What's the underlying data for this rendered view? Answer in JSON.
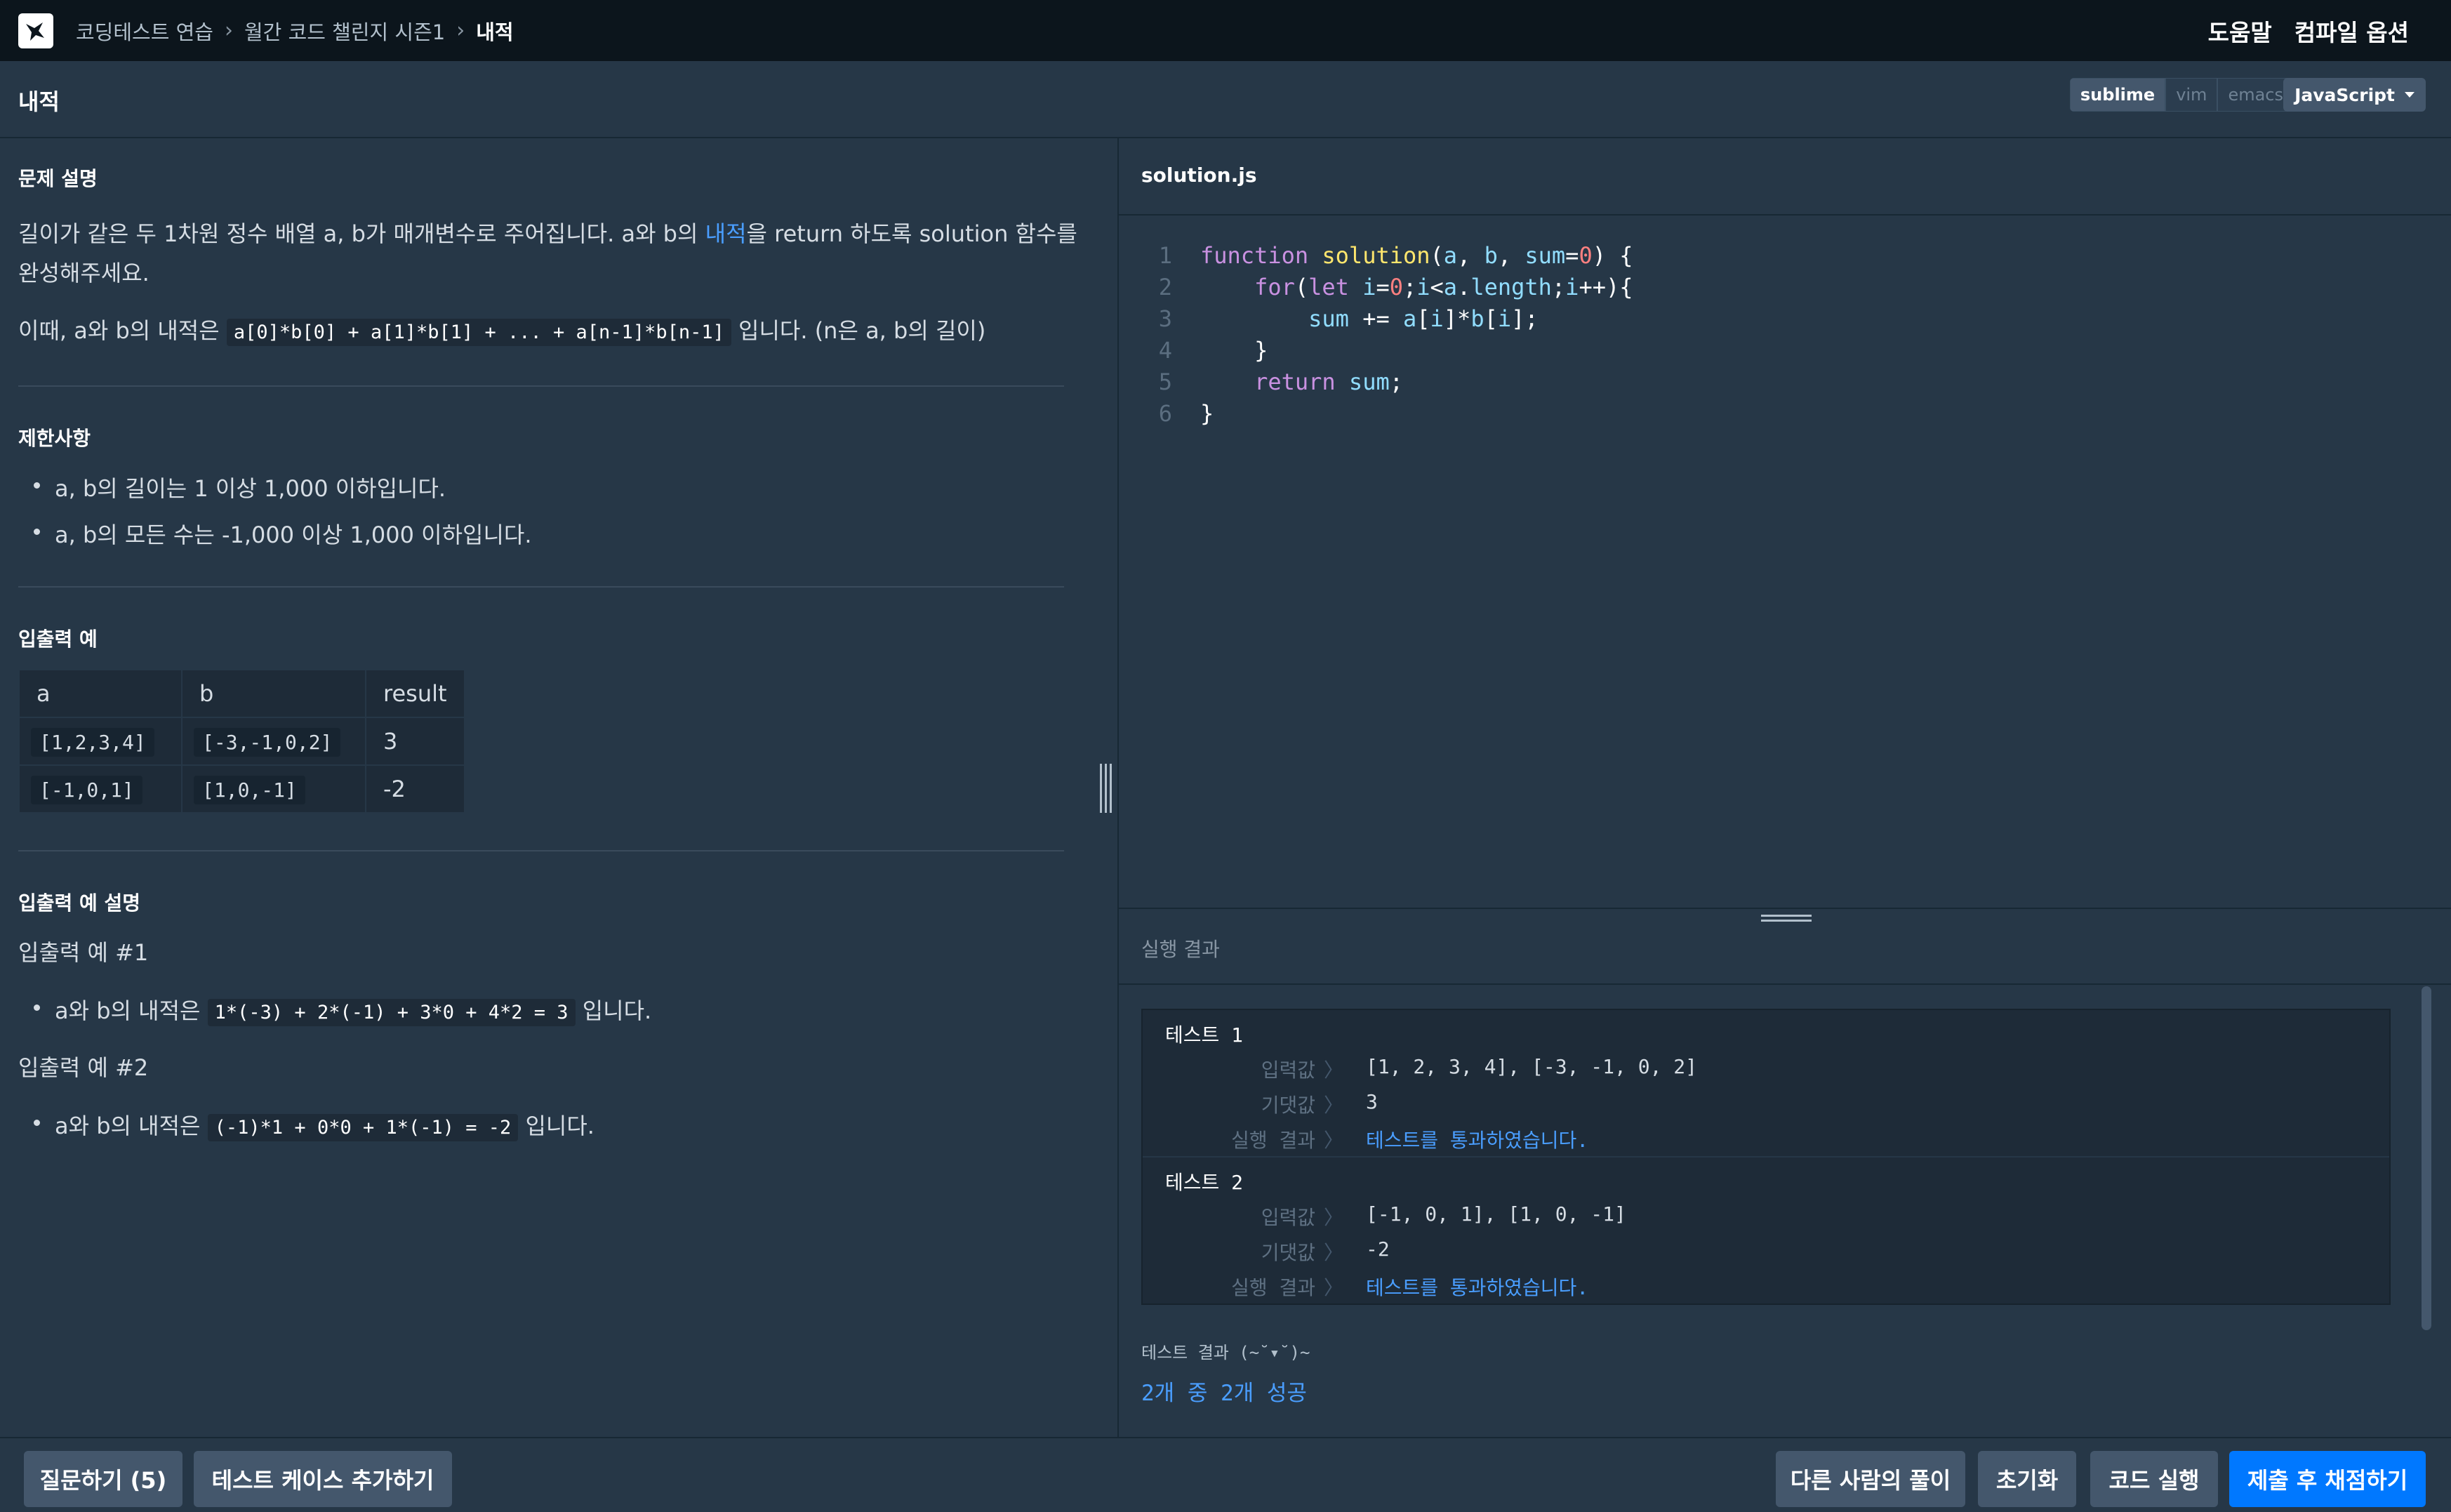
{
  "nav": {
    "breadcrumbs": [
      "코딩테스트 연습",
      "월간 코드 챌린지 시즌1",
      "내적"
    ],
    "help_label": "도움말",
    "compile_options_label": "컴파일 옵션"
  },
  "header": {
    "title": "내적",
    "theme_toggle": [
      "dark",
      "light"
    ],
    "theme_selected": "dark",
    "keymap_toggle": [
      "sublime",
      "vim",
      "emacs"
    ],
    "keymap_selected": "sublime",
    "language": "JavaScript"
  },
  "problem": {
    "desc_title": "문제 설명",
    "desc_line1_a": "길이가 같은 두 1차원 정수 배열 a, b가 매개변수로 주어집니다. a와 b의 ",
    "desc_link": "내적",
    "desc_line1_b": "을 return 하도록 solution 함수를",
    "desc_line2": "완성해주세요.",
    "desc_line3_a": "이때, a와 b의 내적은 ",
    "desc_line3_code": "a[0]*b[0] + a[1]*b[1] + ... + a[n-1]*b[n-1]",
    "desc_line3_b": " 입니다. (n은 a, b의 길이)",
    "constraints_title": "제한사항",
    "constraints": [
      "a, b의 길이는 1 이상 1,000 이하입니다.",
      "a, b의 모든 수는 -1,000 이상 1,000 이하입니다."
    ],
    "io_title": "입출력 예",
    "io_headers": [
      "a",
      "b",
      "result"
    ],
    "io_rows": [
      [
        "[1,2,3,4]",
        "[-3,-1,0,2]",
        "3"
      ],
      [
        "[-1,0,1]",
        "[1,0,-1]",
        "-2"
      ]
    ],
    "io_explain_title": "입출력 예 설명",
    "examples": [
      {
        "title": "입출력 예 #1",
        "prefix": "a와 b의 내적은 ",
        "code": "1*(-3) + 2*(-1) + 3*0 + 4*2 = 3",
        "suffix": " 입니다."
      },
      {
        "title": "입출력 예 #2",
        "prefix": "a와 b의 내적은 ",
        "code": "(-1)*1 + 0*0 + 1*(-1) = -2",
        "suffix": " 입니다."
      }
    ]
  },
  "editor": {
    "filename": "solution.js",
    "line_numbers": [
      "1",
      "2",
      "3",
      "4",
      "5",
      "6"
    ],
    "lines": [
      [
        [
          "kw",
          "function"
        ],
        [
          "pl",
          " "
        ],
        [
          "fn",
          "solution"
        ],
        [
          "pl",
          "("
        ],
        [
          "var",
          "a"
        ],
        [
          "pl",
          ", "
        ],
        [
          "var",
          "b"
        ],
        [
          "pl",
          ", "
        ],
        [
          "var",
          "sum"
        ],
        [
          "pl",
          "="
        ],
        [
          "num",
          "0"
        ],
        [
          "pl",
          ") {"
        ]
      ],
      [
        [
          "pl",
          "    "
        ],
        [
          "kw",
          "for"
        ],
        [
          "pl",
          "("
        ],
        [
          "kw",
          "let"
        ],
        [
          "pl",
          " "
        ],
        [
          "var",
          "i"
        ],
        [
          "pl",
          "="
        ],
        [
          "num",
          "0"
        ],
        [
          "pl",
          ";"
        ],
        [
          "var",
          "i"
        ],
        [
          "pl",
          "<"
        ],
        [
          "var",
          "a"
        ],
        [
          "pl",
          "."
        ],
        [
          "var",
          "length"
        ],
        [
          "pl",
          ";"
        ],
        [
          "var",
          "i"
        ],
        [
          "pl",
          "++){"
        ]
      ],
      [
        [
          "pl",
          "        "
        ],
        [
          "var",
          "sum"
        ],
        [
          "pl",
          " += "
        ],
        [
          "var",
          "a"
        ],
        [
          "pl",
          "["
        ],
        [
          "var",
          "i"
        ],
        [
          "pl",
          "]*"
        ],
        [
          "var",
          "b"
        ],
        [
          "pl",
          "["
        ],
        [
          "var",
          "i"
        ],
        [
          "pl",
          "];"
        ]
      ],
      [
        [
          "pl",
          "    }"
        ]
      ],
      [
        [
          "pl",
          "    "
        ],
        [
          "kw",
          "return"
        ],
        [
          "pl",
          " "
        ],
        [
          "var",
          "sum"
        ],
        [
          "pl",
          ";"
        ]
      ],
      [
        [
          "pl",
          "}"
        ]
      ]
    ]
  },
  "results": {
    "tab_title": "실행 결과",
    "labels": {
      "input": "입력값",
      "expected": "기댓값",
      "result": "실행 결과",
      "arrow": "〉"
    },
    "tests": [
      {
        "title": "테스트 1",
        "input": "[1, 2, 3, 4], [-3, -1, 0, 2]",
        "expected": "3",
        "result": "테스트를 통과하였습니다."
      },
      {
        "title": "테스트 2",
        "input": "[-1, 0, 1], [1, 0, -1]",
        "expected": "-2",
        "result": "테스트를 통과하였습니다."
      }
    ],
    "summary_title": "테스트 결과 (~˘▾˘)~",
    "summary_value": "2개 중 2개 성공"
  },
  "footer": {
    "ask_label": "질문하기 (5)",
    "add_testcase_label": "테스트 케이스 추가하기",
    "others_label": "다른 사람의 풀이",
    "reset_label": "초기화",
    "run_label": "코드 실행",
    "submit_label": "제출 후 채점하기"
  },
  "colors": {
    "background": "#263747",
    "nav": "#0c151c",
    "accent": "#0078ff",
    "link": "#4a9eff",
    "keyword": "#c991e1",
    "function": "#ffe66d",
    "number": "#ff8080",
    "variable": "#91ddff"
  }
}
